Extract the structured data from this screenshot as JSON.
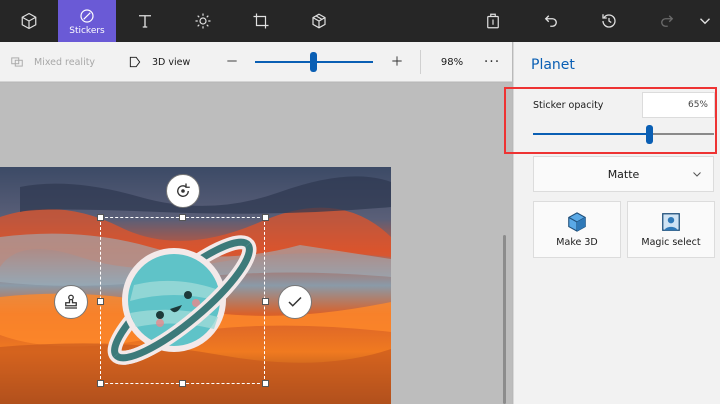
{
  "toolbar": {
    "items": [
      {
        "name": "3d-shapes",
        "icon": "cube-icon"
      },
      {
        "name": "stickers",
        "icon": "sticker-icon",
        "label": "Stickers",
        "active": true
      },
      {
        "name": "text",
        "icon": "text-icon"
      },
      {
        "name": "effects",
        "icon": "sun-icon"
      },
      {
        "name": "canvas",
        "icon": "crop-icon"
      },
      {
        "name": "3d-library",
        "icon": "3d-library-icon"
      }
    ],
    "right": [
      {
        "name": "paste",
        "icon": "clipboard-icon"
      },
      {
        "name": "undo",
        "icon": "undo-icon"
      },
      {
        "name": "history",
        "icon": "history-icon"
      },
      {
        "name": "redo",
        "icon": "redo-icon",
        "disabled": true
      },
      {
        "name": "more",
        "icon": "chevron-down-icon"
      }
    ]
  },
  "subbar": {
    "mixed_reality": "Mixed reality",
    "view_3d": "3D view",
    "zoom_percent": "98%",
    "zoom_value": 0.5,
    "more": "···"
  },
  "panel": {
    "title": "Planet",
    "opacity_label": "Sticker opacity",
    "opacity_value": "65%",
    "opacity_fraction": 0.65,
    "finish_dropdown": "Matte",
    "make_3d": "Make 3D",
    "magic_select": "Magic select"
  },
  "colors": {
    "accent": "#0a5fb4",
    "active_tool": "#6a5ad6",
    "highlight": "#ee3333",
    "toolbar_bg": "#262626"
  }
}
